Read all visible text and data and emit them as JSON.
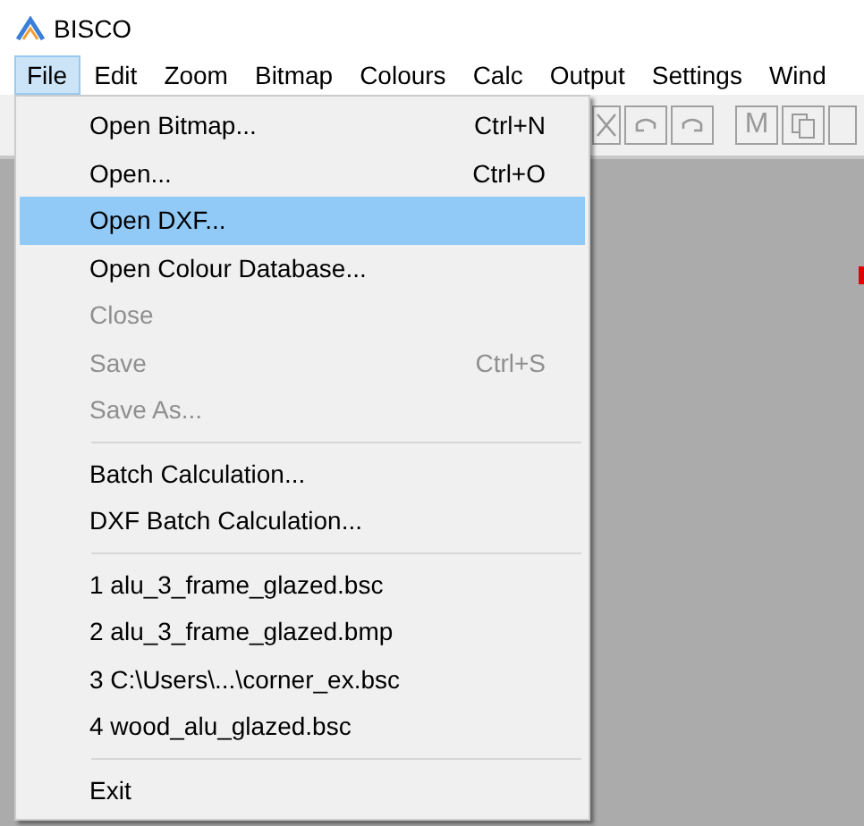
{
  "window": {
    "title": "BISCO"
  },
  "menubar": [
    {
      "label": "File",
      "selected": true
    },
    {
      "label": "Edit",
      "selected": false
    },
    {
      "label": "Zoom",
      "selected": false
    },
    {
      "label": "Bitmap",
      "selected": false
    },
    {
      "label": "Colours",
      "selected": false
    },
    {
      "label": "Calc",
      "selected": false
    },
    {
      "label": "Output",
      "selected": false
    },
    {
      "label": "Settings",
      "selected": false
    },
    {
      "label": "Wind",
      "selected": false
    }
  ],
  "toolbar": [
    {
      "kind": "cut"
    },
    {
      "kind": "undo"
    },
    {
      "kind": "redo"
    },
    {
      "kind": "gap"
    },
    {
      "kind": "text",
      "label": "M"
    },
    {
      "kind": "copy"
    },
    {
      "kind": "partial"
    }
  ],
  "file_menu": [
    {
      "kind": "item",
      "label": "Open Bitmap...",
      "shortcut": "Ctrl+N",
      "disabled": false,
      "selected": false
    },
    {
      "kind": "item",
      "label": "Open...",
      "shortcut": "Ctrl+O",
      "disabled": false,
      "selected": false
    },
    {
      "kind": "item",
      "label": "Open DXF...",
      "disabled": false,
      "selected": true
    },
    {
      "kind": "item",
      "label": "Open Colour Database...",
      "disabled": false,
      "selected": false
    },
    {
      "kind": "item",
      "label": "Close",
      "disabled": true,
      "selected": false
    },
    {
      "kind": "item",
      "label": "Save",
      "shortcut": "Ctrl+S",
      "disabled": true,
      "selected": false
    },
    {
      "kind": "item",
      "label": "Save As...",
      "disabled": true,
      "selected": false
    },
    {
      "kind": "separator"
    },
    {
      "kind": "item",
      "label": "Batch Calculation...",
      "disabled": false,
      "selected": false
    },
    {
      "kind": "item",
      "label": "DXF Batch Calculation...",
      "disabled": false,
      "selected": false
    },
    {
      "kind": "separator"
    },
    {
      "kind": "item",
      "label": "1 alu_3_frame_glazed.bsc",
      "disabled": false,
      "selected": false
    },
    {
      "kind": "item",
      "label": "2 alu_3_frame_glazed.bmp",
      "disabled": false,
      "selected": false
    },
    {
      "kind": "item",
      "label": "3 C:\\Users\\...\\corner_ex.bsc",
      "disabled": false,
      "selected": false
    },
    {
      "kind": "item",
      "label": "4 wood_alu_glazed.bsc",
      "disabled": false,
      "selected": false
    },
    {
      "kind": "separator"
    },
    {
      "kind": "item",
      "label": "Exit",
      "disabled": false,
      "selected": false
    }
  ]
}
